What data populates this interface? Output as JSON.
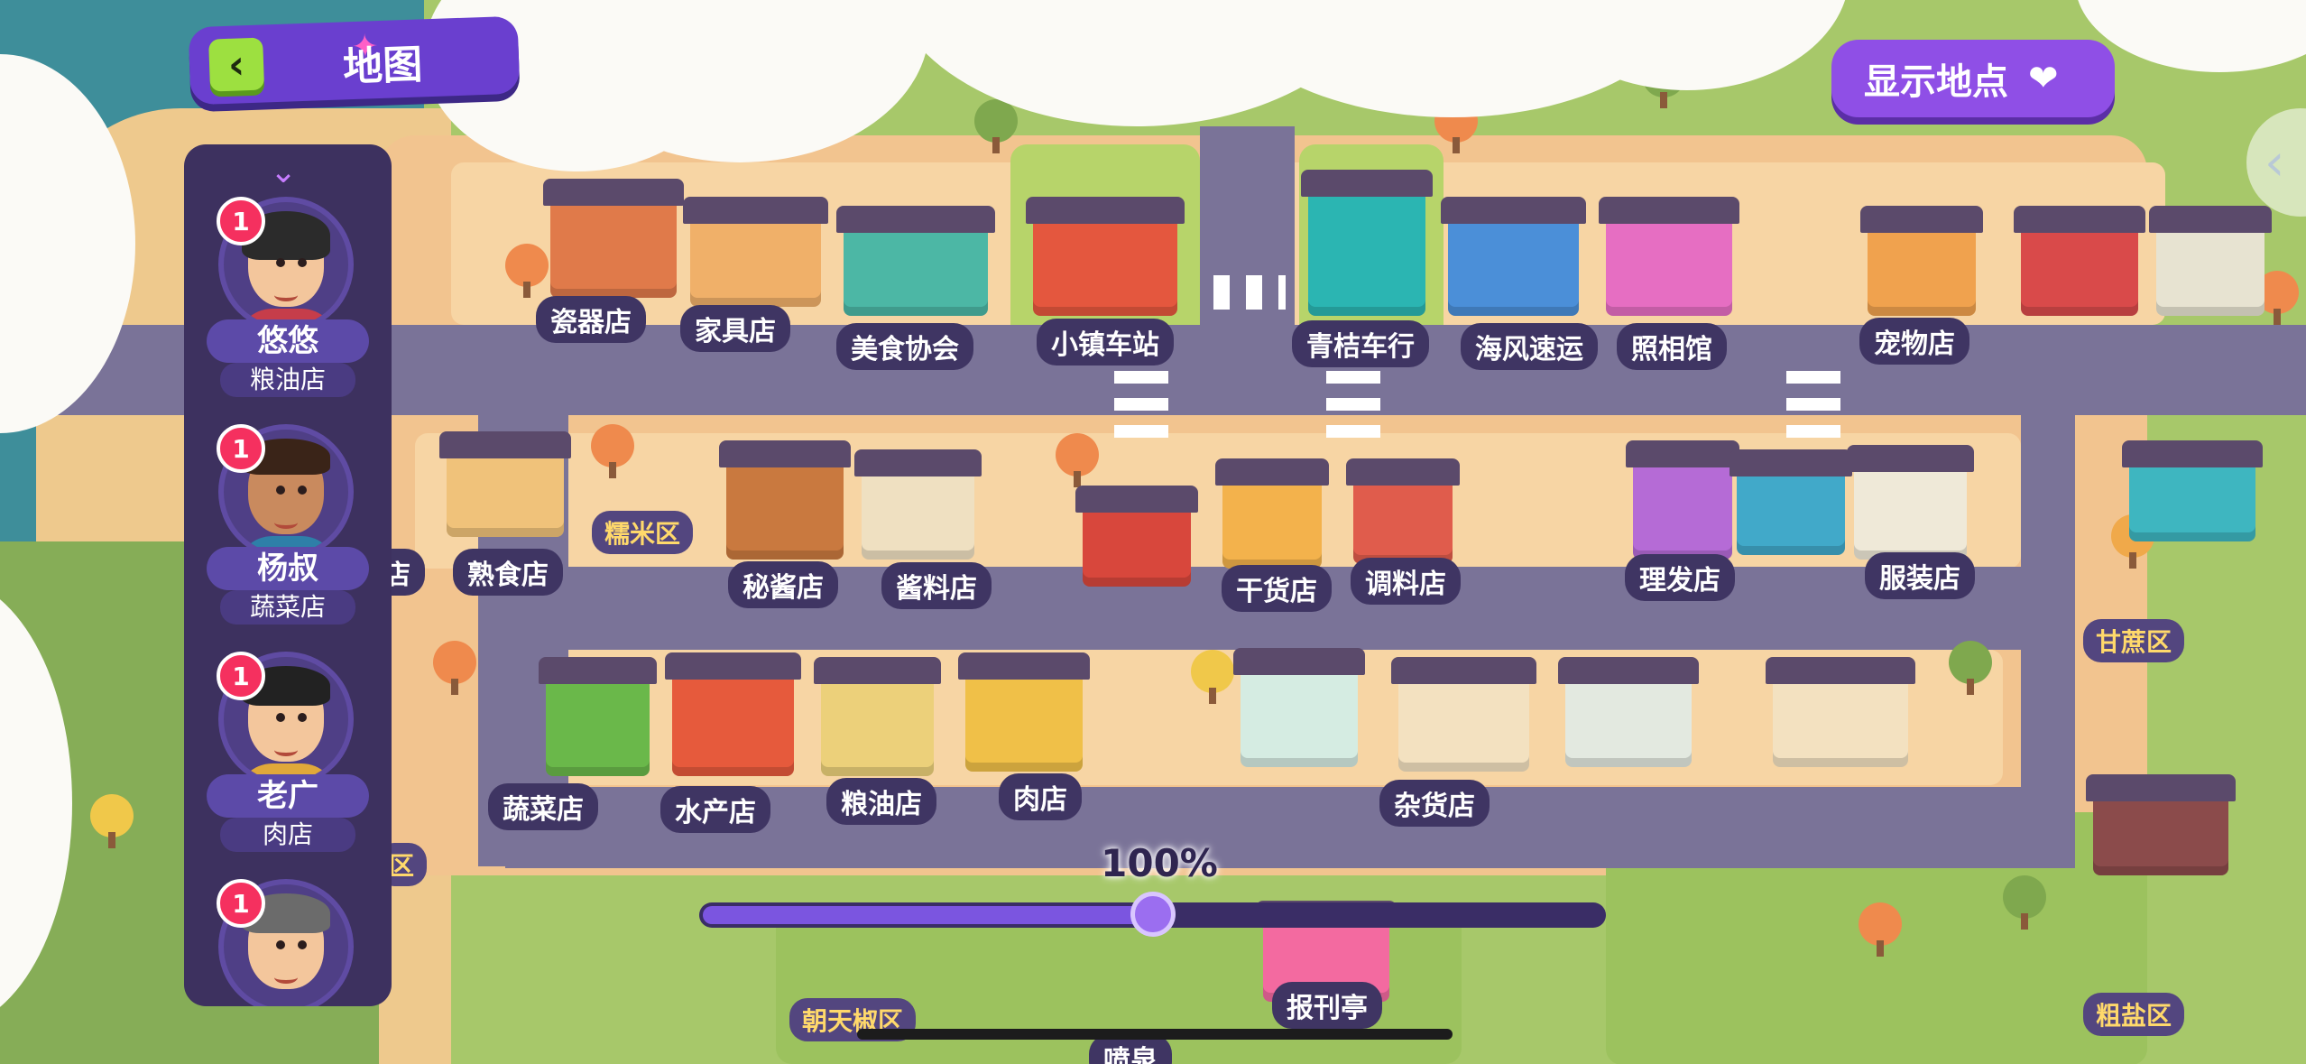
{
  "header": {
    "title": "地图",
    "back_icon": "chevron-left-icon"
  },
  "show_places_button": {
    "label": "显示地点",
    "icon": "heart-icon"
  },
  "character_panel": {
    "scroll_icon": "chevron-down-icon",
    "characters": [
      {
        "name": "悠悠",
        "shop": "粮油店",
        "badge": "1"
      },
      {
        "name": "杨叔",
        "shop": "蔬菜店",
        "badge": "1"
      },
      {
        "name": "老广",
        "shop": "肉店",
        "badge": "1"
      },
      {
        "name": "",
        "shop": "",
        "badge": "1"
      }
    ]
  },
  "map": {
    "shops_row1": [
      "瓷器店",
      "家具店",
      "美食协会",
      "小镇车站",
      "青桔车行",
      "海风速运",
      "照相馆",
      "宠物店"
    ],
    "shops_row2": [
      "店",
      "熟食店",
      "秘酱店",
      "酱料店",
      "干货店",
      "调料店",
      "理发店",
      "服装店"
    ],
    "shops_row3": [
      "蔬菜店",
      "水产店",
      "粮油店",
      "肉店",
      "杂货店"
    ],
    "shops_bottom": [
      "报刊亭",
      "喷泉"
    ],
    "zones": [
      "糯米区",
      "甘蔗区",
      "区",
      "朝天椒区",
      "粗盐区"
    ]
  },
  "zoom": {
    "label": "100%",
    "value": 0.5
  },
  "colors": {
    "accent": "#8f4fe6",
    "panel": "#3d315f",
    "badge": "#f5305f",
    "back_button": "#9de040"
  }
}
